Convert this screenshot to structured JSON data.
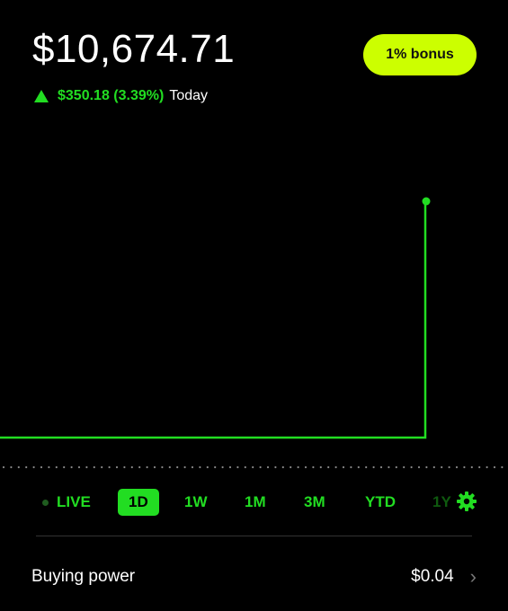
{
  "portfolio": {
    "balance": "$10,674.71",
    "bonus_label": "1% bonus",
    "change_amount": "$350.18 (3.39%)",
    "change_period": "Today",
    "accent_color": "#22dd22",
    "bonus_color": "#ccff00"
  },
  "ranges": {
    "live": "LIVE",
    "d1": "1D",
    "w1": "1W",
    "m1": "1M",
    "m3": "3M",
    "ytd": "YTD",
    "y1": "1Y",
    "selected": "1D"
  },
  "buying_power": {
    "label": "Buying power",
    "value": "$0.04"
  },
  "chart_data": {
    "type": "line",
    "series": [
      {
        "values": [
          0,
          0,
          0,
          0,
          0,
          0,
          0,
          0,
          0,
          0,
          0,
          0,
          0,
          0,
          0,
          0,
          0,
          0,
          0,
          1
        ]
      }
    ],
    "baseline": "dotted",
    "end_marker": true
  }
}
